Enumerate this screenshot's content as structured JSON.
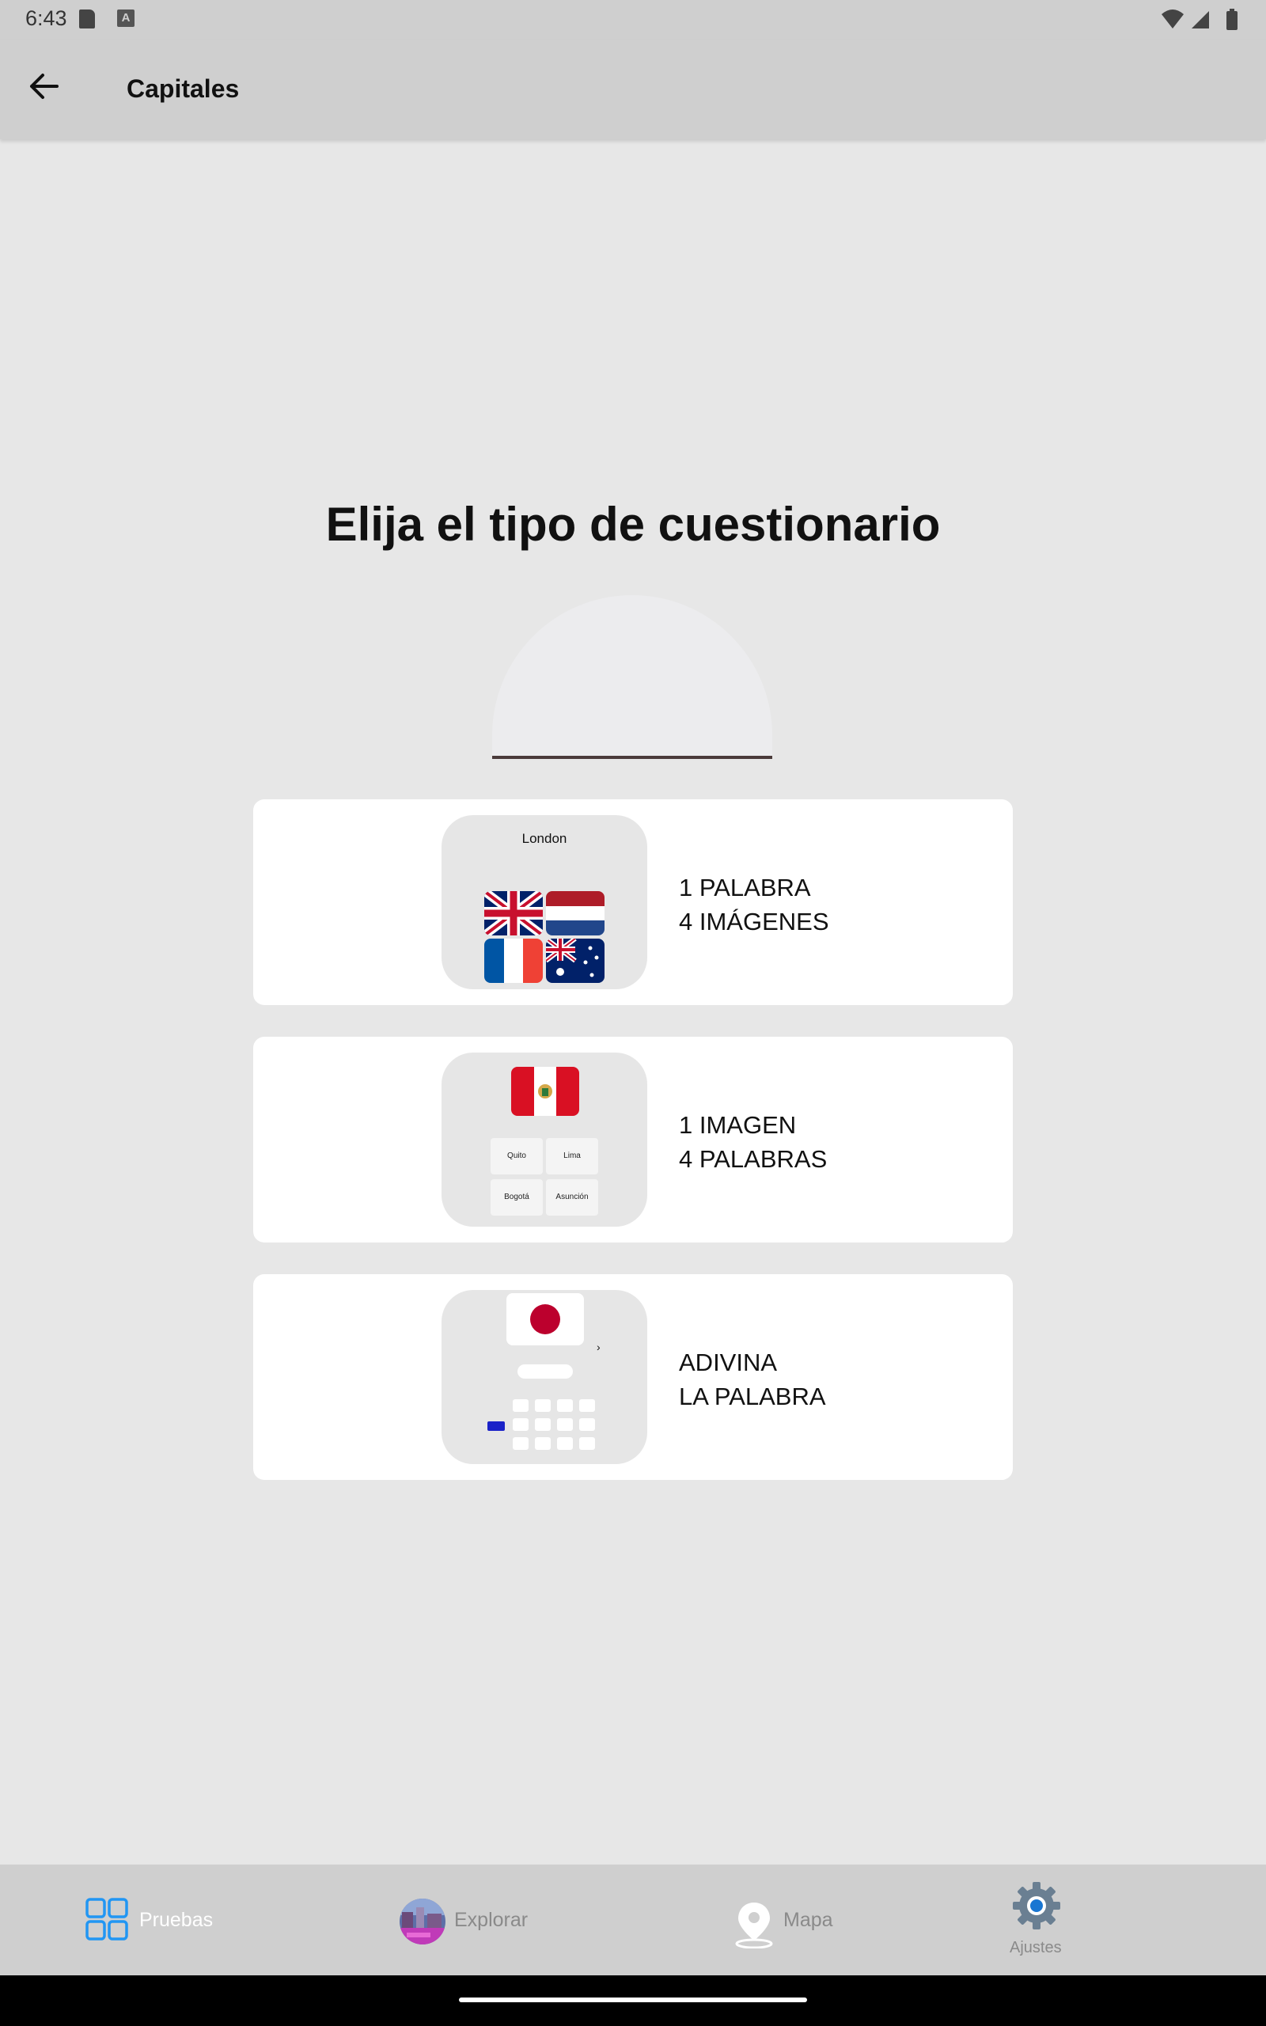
{
  "status_bar": {
    "time": "6:43"
  },
  "app_bar": {
    "title": "Capitales"
  },
  "main": {
    "heading": "Elija el tipo de cuestionario",
    "cards": [
      {
        "line1": "1 PALABRA",
        "line2": "4 IMÁGENES",
        "preview_city": "London"
      },
      {
        "line1": "1 IMAGEN",
        "line2": "4 PALABRAS",
        "preview_options": [
          "Quito",
          "Lima",
          "Bogotá",
          "Asunción"
        ]
      },
      {
        "line1": "ADIVINA",
        "line2": "LA PALABRA"
      }
    ]
  },
  "bottom_nav": {
    "items": [
      {
        "label": "Pruebas",
        "active": true
      },
      {
        "label": "Explorar"
      },
      {
        "label": "Mapa"
      },
      {
        "label": "Ajustes"
      }
    ]
  },
  "colors": {
    "accent": "#2196f3",
    "background": "#e7e7e7",
    "bar": "#cfcfcf"
  }
}
